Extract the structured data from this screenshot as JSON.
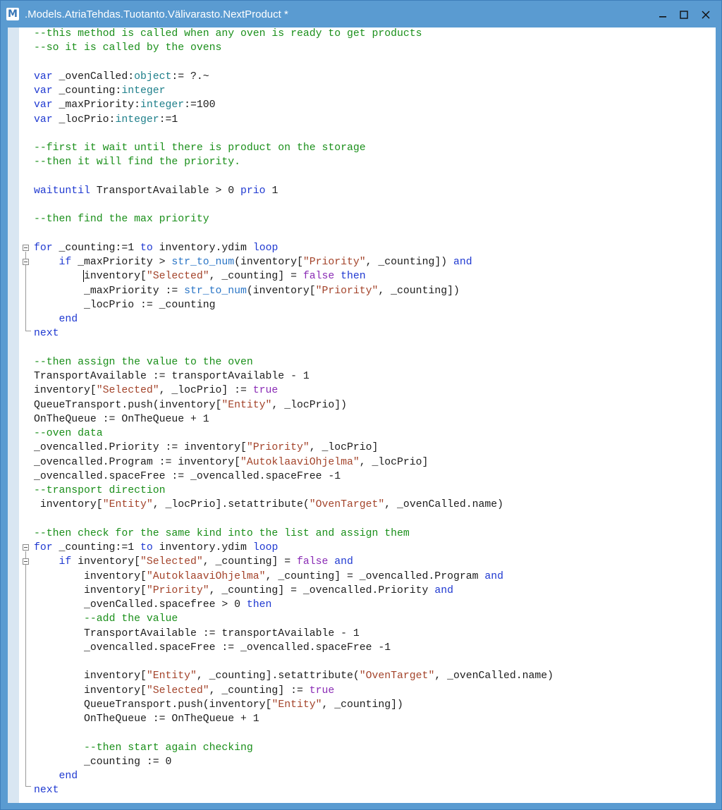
{
  "window": {
    "title": ".Models.AtriaTehdas.Tuotanto.Välivarasto.NextProduct *",
    "app_icon_letter": "M",
    "buttons": {
      "minimize_icon": "minimize-icon",
      "maximize_icon": "maximize-icon",
      "close_icon": "close-icon"
    },
    "accent_color": "#5a9bd1"
  },
  "editor": {
    "lines": [
      [
        {
          "t": "--this method is called when any oven is ready to get products",
          "c": "c"
        }
      ],
      [
        {
          "t": "--so it is called by the ovens",
          "c": "c"
        }
      ],
      [],
      [
        {
          "t": "var",
          "c": "k"
        },
        {
          "t": " _ovenCalled:"
        },
        {
          "t": "object",
          "c": "t"
        },
        {
          "t": ":= ?.~"
        }
      ],
      [
        {
          "t": "var",
          "c": "k"
        },
        {
          "t": " _counting:"
        },
        {
          "t": "integer",
          "c": "t"
        }
      ],
      [
        {
          "t": "var",
          "c": "k"
        },
        {
          "t": " _maxPriority:"
        },
        {
          "t": "integer",
          "c": "t"
        },
        {
          "t": ":=100"
        }
      ],
      [
        {
          "t": "var",
          "c": "k"
        },
        {
          "t": " _locPrio:"
        },
        {
          "t": "integer",
          "c": "t"
        },
        {
          "t": ":=1"
        }
      ],
      [],
      [
        {
          "t": "--first it wait until there is product on the storage",
          "c": "c"
        }
      ],
      [
        {
          "t": "--then it will find the priority.",
          "c": "c"
        }
      ],
      [],
      [
        {
          "t": "waituntil",
          "c": "k"
        },
        {
          "t": " TransportAvailable > 0 "
        },
        {
          "t": "prio",
          "c": "k"
        },
        {
          "t": " 1"
        }
      ],
      [],
      [
        {
          "t": "--then find the max priority",
          "c": "c"
        }
      ],
      [],
      [
        {
          "t": "for",
          "c": "k"
        },
        {
          "t": " _counting:=1 "
        },
        {
          "t": "to",
          "c": "k"
        },
        {
          "t": " inventory.ydim "
        },
        {
          "t": "loop",
          "c": "k"
        }
      ],
      [
        {
          "t": "    "
        },
        {
          "t": "if",
          "c": "k"
        },
        {
          "t": " _maxPriority > "
        },
        {
          "t": "str_to_num",
          "c": "f"
        },
        {
          "t": "(inventory["
        },
        {
          "t": "\"Priority\"",
          "c": "s"
        },
        {
          "t": ", _counting]) "
        },
        {
          "t": "and",
          "c": "k"
        }
      ],
      [
        {
          "t": "        inventory["
        },
        {
          "t": "\"Selected\"",
          "c": "s"
        },
        {
          "t": ", _counting] = "
        },
        {
          "t": "false",
          "c": "v"
        },
        {
          "t": " "
        },
        {
          "t": "then",
          "c": "k"
        }
      ],
      [
        {
          "t": "        _maxPriority := "
        },
        {
          "t": "str_to_num",
          "c": "f"
        },
        {
          "t": "(inventory["
        },
        {
          "t": "\"Priority\"",
          "c": "s"
        },
        {
          "t": ", _counting])"
        }
      ],
      [
        {
          "t": "        _locPrio := _counting"
        }
      ],
      [
        {
          "t": "    "
        },
        {
          "t": "end",
          "c": "k"
        }
      ],
      [
        {
          "t": "next",
          "c": "k"
        }
      ],
      [],
      [
        {
          "t": "--then assign the value to the oven",
          "c": "c"
        }
      ],
      [
        {
          "t": "TransportAvailable := transportAvailable - 1"
        }
      ],
      [
        {
          "t": "inventory["
        },
        {
          "t": "\"Selected\"",
          "c": "s"
        },
        {
          "t": ", _locPrio] := "
        },
        {
          "t": "true",
          "c": "v"
        }
      ],
      [
        {
          "t": "QueueTransport.push(inventory["
        },
        {
          "t": "\"Entity\"",
          "c": "s"
        },
        {
          "t": ", _locPrio])"
        }
      ],
      [
        {
          "t": "OnTheQueue := OnTheQueue + 1"
        }
      ],
      [
        {
          "t": "--oven data",
          "c": "c"
        }
      ],
      [
        {
          "t": "_ovencalled.Priority := inventory["
        },
        {
          "t": "\"Priority\"",
          "c": "s"
        },
        {
          "t": ", _locPrio]"
        }
      ],
      [
        {
          "t": "_ovencalled.Program := inventory["
        },
        {
          "t": "\"AutoklaaviOhjelma\"",
          "c": "s"
        },
        {
          "t": ", _locPrio]"
        }
      ],
      [
        {
          "t": "_ovencalled.spaceFree := _ovencalled.spaceFree -1"
        }
      ],
      [
        {
          "t": "--transport direction",
          "c": "c"
        }
      ],
      [
        {
          "t": " inventory["
        },
        {
          "t": "\"Entity\"",
          "c": "s"
        },
        {
          "t": ", _locPrio].setattribute("
        },
        {
          "t": "\"OvenTarget\"",
          "c": "s"
        },
        {
          "t": ", _ovenCalled.name)"
        }
      ],
      [],
      [
        {
          "t": "--then check for the same kind into the list and assign them",
          "c": "c"
        }
      ],
      [
        {
          "t": "for",
          "c": "k"
        },
        {
          "t": " _counting:=1 "
        },
        {
          "t": "to",
          "c": "k"
        },
        {
          "t": " inventory.ydim "
        },
        {
          "t": "loop",
          "c": "k"
        }
      ],
      [
        {
          "t": "    "
        },
        {
          "t": "if",
          "c": "k"
        },
        {
          "t": " inventory["
        },
        {
          "t": "\"Selected\"",
          "c": "s"
        },
        {
          "t": ", _counting] = "
        },
        {
          "t": "false",
          "c": "v"
        },
        {
          "t": " "
        },
        {
          "t": "and",
          "c": "k"
        }
      ],
      [
        {
          "t": "        inventory["
        },
        {
          "t": "\"AutoklaaviOhjelma\"",
          "c": "s"
        },
        {
          "t": ", _counting] = _ovencalled.Program "
        },
        {
          "t": "and",
          "c": "k"
        }
      ],
      [
        {
          "t": "        inventory["
        },
        {
          "t": "\"Priority\"",
          "c": "s"
        },
        {
          "t": ", _counting] = _ovencalled.Priority "
        },
        {
          "t": "and",
          "c": "k"
        }
      ],
      [
        {
          "t": "        _ovenCalled.spacefree > 0 "
        },
        {
          "t": "then",
          "c": "k"
        }
      ],
      [
        {
          "t": "        "
        },
        {
          "t": "--add the value",
          "c": "c"
        }
      ],
      [
        {
          "t": "        TransportAvailable := transportAvailable - 1"
        }
      ],
      [
        {
          "t": "        _ovencalled.spaceFree := _ovencalled.spaceFree -1"
        }
      ],
      [],
      [
        {
          "t": "        inventory["
        },
        {
          "t": "\"Entity\"",
          "c": "s"
        },
        {
          "t": ", _counting].setattribute("
        },
        {
          "t": "\"OvenTarget\"",
          "c": "s"
        },
        {
          "t": ", _ovenCalled.name)"
        }
      ],
      [
        {
          "t": "        inventory["
        },
        {
          "t": "\"Selected\"",
          "c": "s"
        },
        {
          "t": ", _counting] := "
        },
        {
          "t": "true",
          "c": "v"
        }
      ],
      [
        {
          "t": "        QueueTransport.push(inventory["
        },
        {
          "t": "\"Entity\"",
          "c": "s"
        },
        {
          "t": ", _counting])"
        }
      ],
      [
        {
          "t": "        OnTheQueue := OnTheQueue + 1"
        }
      ],
      [],
      [
        {
          "t": "        "
        },
        {
          "t": "--then start again checking",
          "c": "c"
        }
      ],
      [
        {
          "t": "        _counting := 0"
        }
      ],
      [
        {
          "t": "    "
        },
        {
          "t": "end",
          "c": "k"
        }
      ],
      [
        {
          "t": "next",
          "c": "k"
        }
      ]
    ]
  }
}
